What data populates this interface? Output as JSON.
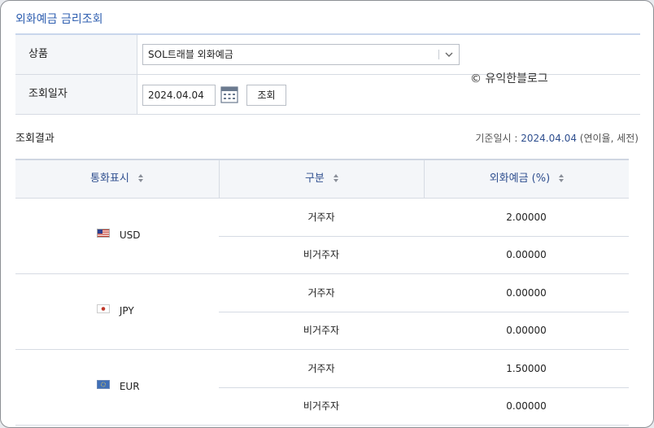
{
  "page": {
    "title": "외화예금 금리조회"
  },
  "form": {
    "product_label": "상품",
    "product_value": "SOL트래블 외화예금",
    "date_label": "조회일자",
    "date_value": "2024.04.04",
    "search_button": "조회"
  },
  "watermark": "© 유익한블로그",
  "result": {
    "label": "조회결과",
    "base_prefix": "기준일시 :",
    "base_date": "2024.04.04",
    "base_suffix": "(연이율, 세전)"
  },
  "table": {
    "headers": [
      "통화표시",
      "구분",
      "외화예금 (%)"
    ],
    "rows": [
      {
        "currency": "USD",
        "items": [
          {
            "kind": "거주자",
            "rate": "2.00000"
          },
          {
            "kind": "비거주자",
            "rate": "0.00000"
          }
        ]
      },
      {
        "currency": "JPY",
        "items": [
          {
            "kind": "거주자",
            "rate": "0.00000"
          },
          {
            "kind": "비거주자",
            "rate": "0.00000"
          }
        ]
      },
      {
        "currency": "EUR",
        "items": [
          {
            "kind": "거주자",
            "rate": "1.50000"
          },
          {
            "kind": "비거주자",
            "rate": "0.00000"
          }
        ]
      }
    ]
  }
}
